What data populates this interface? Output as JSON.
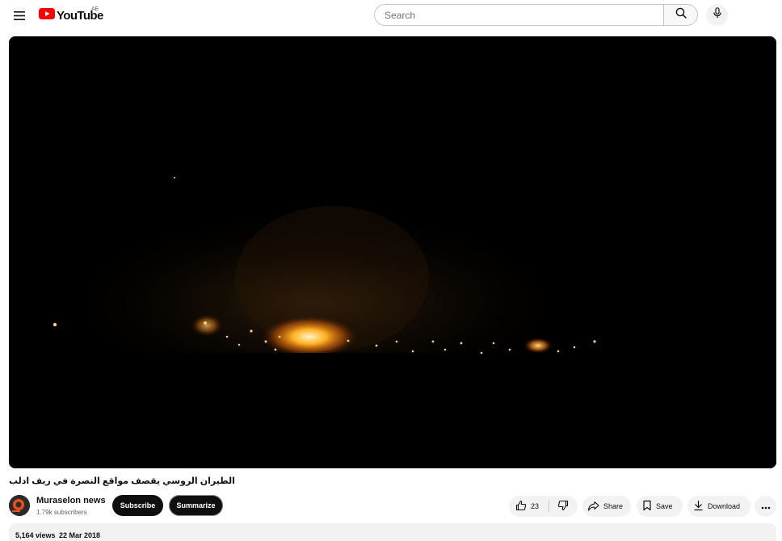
{
  "header": {
    "logo_text": "YouTube",
    "region": "AE",
    "search_placeholder": "Search",
    "brand_color": "#ff0000"
  },
  "video": {
    "title": "الطيران الروسي يقصف مواقع النصرة في ريف ادلب"
  },
  "channel": {
    "name": "Muraselon news",
    "subscribers": "1.79k subscribers",
    "subscribe_label": "Subscribe",
    "summarize_label": "Summarize"
  },
  "actions": {
    "likes": "23",
    "share_label": "Share",
    "save_label": "Save",
    "download_label": "Download"
  },
  "description": {
    "views": "5,164 views",
    "date": "22 Mar 2018"
  },
  "icons": [
    "menu-icon",
    "youtube-logo-icon",
    "search-icon",
    "mic-icon",
    "thumbs-up-icon",
    "thumbs-down-icon",
    "share-icon",
    "save-icon",
    "download-icon",
    "more-icon"
  ]
}
